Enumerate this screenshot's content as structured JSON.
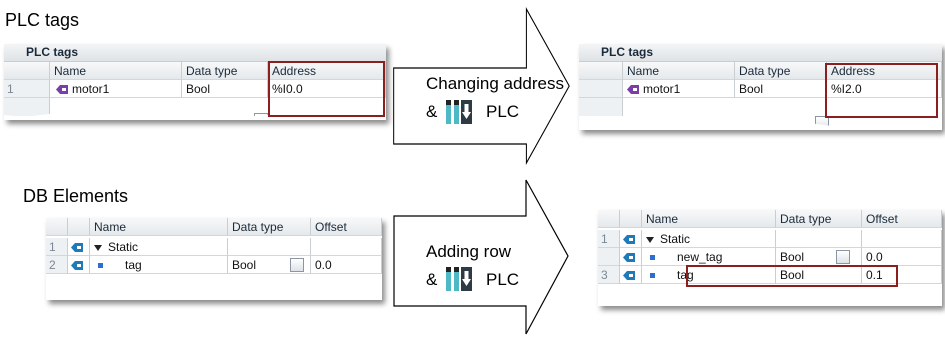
{
  "titles": {
    "plc_tags": "PLC tags",
    "db_elements": "DB Elements"
  },
  "plc_before": {
    "header": "PLC tags",
    "columns": [
      "Name",
      "Data type",
      "Address"
    ],
    "row": {
      "num": "1",
      "name": "motor1",
      "type": "Bool",
      "address": "%I0.0"
    }
  },
  "plc_after": {
    "header": "PLC tags",
    "columns": [
      "Name",
      "Data type",
      "Address"
    ],
    "row": {
      "name": "motor1",
      "type": "Bool",
      "address": "%I2.0"
    }
  },
  "arrow1": {
    "line1": "Changing address",
    "amp": "&",
    "plc": "PLC"
  },
  "arrow2": {
    "line1": "Adding row",
    "amp": "&",
    "plc": "PLC"
  },
  "db_before": {
    "columns": [
      "Name",
      "Data type",
      "Offset"
    ],
    "rows": [
      {
        "num": "1",
        "name": "Static"
      },
      {
        "num": "2",
        "name": "tag",
        "type": "Bool",
        "offset": "0.0"
      }
    ]
  },
  "db_after": {
    "columns": [
      "Name",
      "Data type",
      "Offset"
    ],
    "rows": [
      {
        "num": "1",
        "name": "Static"
      },
      {
        "name": "new_tag",
        "type": "Bool",
        "offset": "0.0"
      },
      {
        "num": "3",
        "name": "tag",
        "type": "Bool",
        "offset": "0.1"
      }
    ]
  },
  "colors": {
    "highlight_border": "#8b1e1e",
    "download_icon": "#2aa6b8"
  },
  "icons": [
    "tag-icon",
    "download-to-plc-icon",
    "expand-triangle-icon",
    "browse-icon"
  ]
}
